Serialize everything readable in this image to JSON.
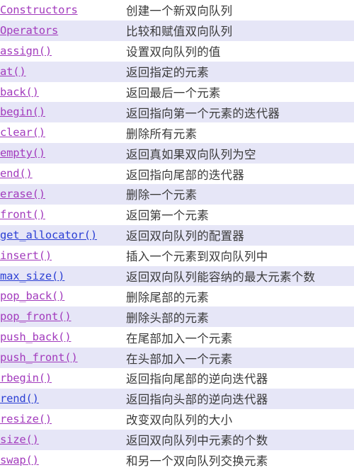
{
  "page": {
    "kind": "reference-method-table",
    "colors": {
      "row_alt_background": "#e6e6f7",
      "row_background": "#ffffff",
      "visited_link": "#a23bbd",
      "unvisited_link": "#2b3fd4",
      "description_text": "#3a3a3a"
    }
  },
  "table": {
    "rows": [
      {
        "name": "Constructors",
        "link_state": "visited",
        "description": "创建一个新双向队列"
      },
      {
        "name": "Operators",
        "link_state": "visited",
        "description": "比较和赋值双向队列"
      },
      {
        "name": "assign()",
        "link_state": "visited",
        "description": "设置双向队列的值"
      },
      {
        "name": "at()",
        "link_state": "visited",
        "description": "返回指定的元素"
      },
      {
        "name": "back()",
        "link_state": "visited",
        "description": "返回最后一个元素"
      },
      {
        "name": "begin()",
        "link_state": "visited",
        "description": "返回指向第一个元素的迭代器"
      },
      {
        "name": "clear()",
        "link_state": "visited",
        "description": "删除所有元素"
      },
      {
        "name": "empty()",
        "link_state": "visited",
        "description": "返回真如果双向队列为空"
      },
      {
        "name": "end()",
        "link_state": "visited",
        "description": "返回指向尾部的迭代器"
      },
      {
        "name": "erase()",
        "link_state": "visited",
        "description": "删除一个元素"
      },
      {
        "name": "front()",
        "link_state": "visited",
        "description": "返回第一个元素"
      },
      {
        "name": "get_allocator()",
        "link_state": "unvisited",
        "description": "返回双向队列的配置器"
      },
      {
        "name": "insert()",
        "link_state": "visited",
        "description": "插入一个元素到双向队列中"
      },
      {
        "name": "max_size()",
        "link_state": "unvisited",
        "description": "返回双向队列能容纳的最大元素个数"
      },
      {
        "name": "pop_back()",
        "link_state": "visited",
        "description": "删除尾部的元素"
      },
      {
        "name": "pop_front()",
        "link_state": "visited",
        "description": "删除头部的元素"
      },
      {
        "name": "push_back()",
        "link_state": "visited",
        "description": "在尾部加入一个元素"
      },
      {
        "name": "push_front()",
        "link_state": "visited",
        "description": "在头部加入一个元素"
      },
      {
        "name": "rbegin()",
        "link_state": "visited",
        "description": "返回指向尾部的逆向迭代器"
      },
      {
        "name": "rend()",
        "link_state": "unvisited",
        "description": "返回指向头部的逆向迭代器"
      },
      {
        "name": "resize()",
        "link_state": "visited",
        "description": "改变双向队列的大小"
      },
      {
        "name": "size()",
        "link_state": "visited",
        "description": "返回双向队列中元素的个数"
      },
      {
        "name": "swap()",
        "link_state": "visited",
        "description": "和另一个双向队列交换元素"
      }
    ]
  }
}
